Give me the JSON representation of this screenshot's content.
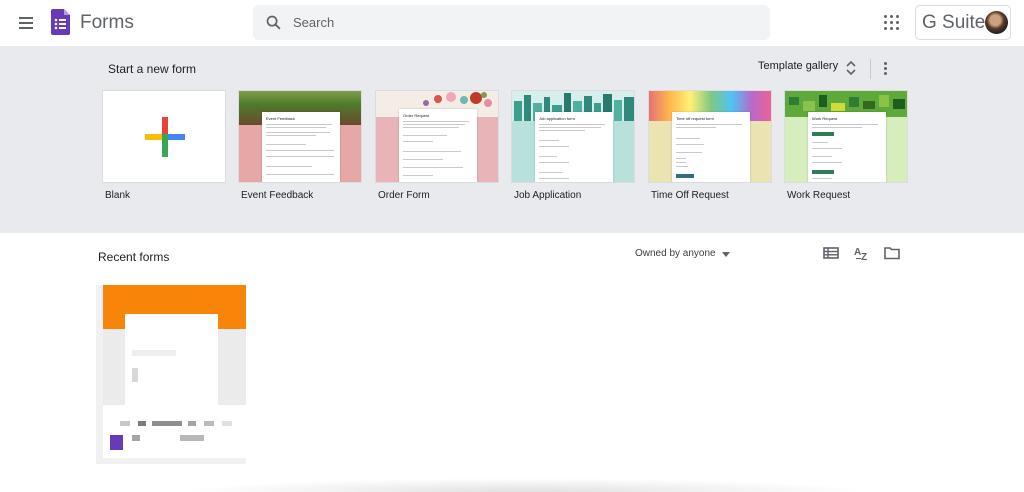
{
  "header": {
    "app_title": "Forms",
    "search_placeholder": "Search",
    "account_badge_text": "G Suite"
  },
  "templates": {
    "heading": "Start a new form",
    "gallery_label": "Template gallery",
    "items": [
      {
        "label": "Blank",
        "form_title": ""
      },
      {
        "label": "Event Feedback",
        "form_title": "Event Feedback"
      },
      {
        "label": "Order Form",
        "form_title": "Order Request"
      },
      {
        "label": "Job Application",
        "form_title": "Job application form"
      },
      {
        "label": "Time Off Request",
        "form_title": "Time off request form"
      },
      {
        "label": "Work Request",
        "form_title": "Work Request"
      }
    ]
  },
  "recent": {
    "heading": "Recent forms",
    "owner_filter": "Owned by anyone"
  },
  "colors": {
    "forms_purple": "#673ab7",
    "recent_card_accent": "#f6850a",
    "template_band": "#e8eaed"
  },
  "icons": [
    "menu-icon",
    "forms-logo-icon",
    "search-icon",
    "apps-grid-icon",
    "avatar",
    "unfold-icon",
    "more-vert-icon",
    "plus-icon",
    "caret-down-icon",
    "list-view-icon",
    "sort-az-icon",
    "folder-icon",
    "form-file-icon"
  ]
}
